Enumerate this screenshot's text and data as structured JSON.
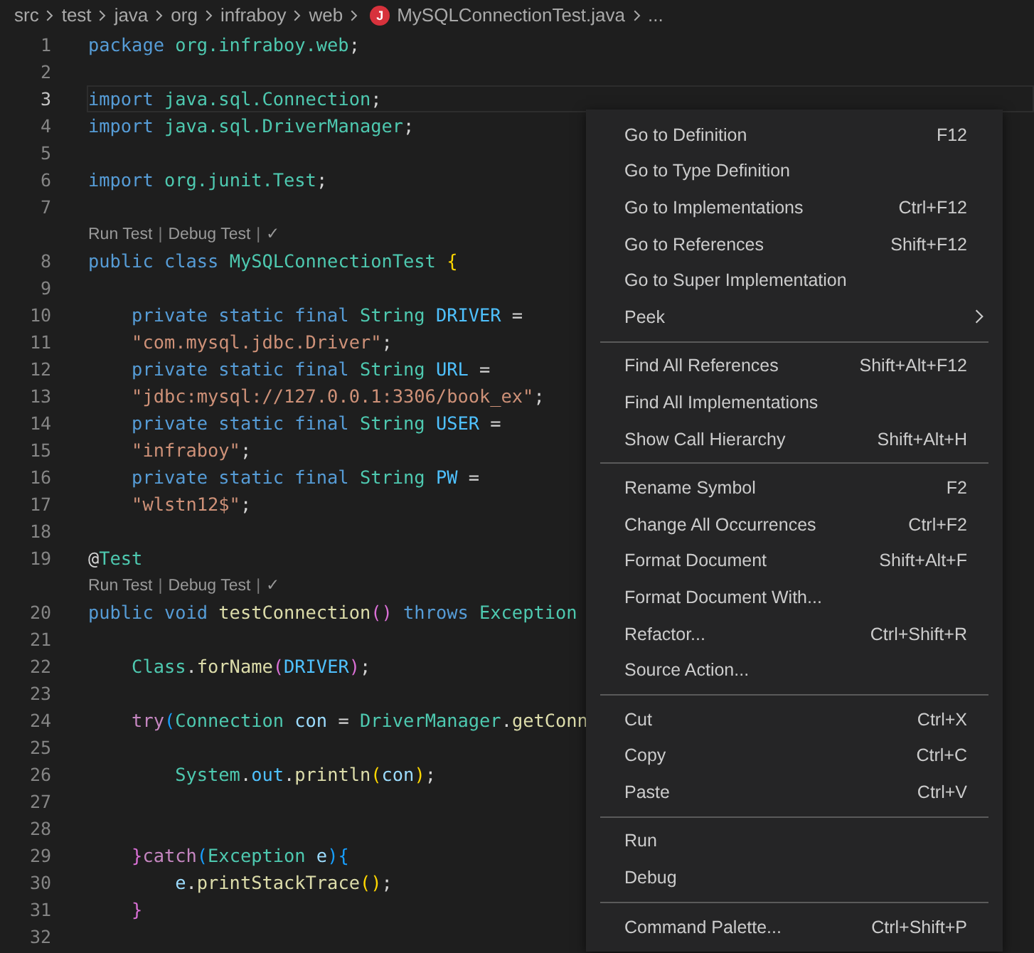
{
  "breadcrumb": {
    "segments": [
      "src",
      "test",
      "java",
      "org",
      "infraboy",
      "web"
    ],
    "file": {
      "badge": "J",
      "name": "MySQLConnectionTest.java"
    },
    "more": "..."
  },
  "rows": [
    {
      "kind": "code",
      "n": "1",
      "current": false,
      "code": [
        {
          "t": "package ",
          "kind": "kw"
        },
        {
          "t": "org.infraboy.web",
          "kind": "type"
        },
        {
          "t": ";",
          "kind": "punc"
        }
      ]
    },
    {
      "kind": "code",
      "n": "2",
      "current": false,
      "code": []
    },
    {
      "kind": "code",
      "n": "3",
      "current": true,
      "code": [
        {
          "t": "import ",
          "kind": "kw"
        },
        {
          "t": "java.sql.Connection",
          "kind": "type"
        },
        {
          "t": ";",
          "kind": "punc"
        }
      ]
    },
    {
      "kind": "code",
      "n": "4",
      "current": false,
      "code": [
        {
          "t": "import ",
          "kind": "kw"
        },
        {
          "t": "java.sql.DriverManager",
          "kind": "type"
        },
        {
          "t": ";",
          "kind": "punc"
        }
      ]
    },
    {
      "kind": "code",
      "n": "5",
      "current": false,
      "code": []
    },
    {
      "kind": "code",
      "n": "6",
      "current": false,
      "code": [
        {
          "t": "import ",
          "kind": "kw"
        },
        {
          "t": "org.junit.Test",
          "kind": "type"
        },
        {
          "t": ";",
          "kind": "punc"
        }
      ]
    },
    {
      "kind": "code",
      "n": "7",
      "current": false,
      "code": []
    },
    {
      "kind": "lens",
      "parts": [
        {
          "t": "Run Test",
          "kind": "link"
        },
        {
          "t": "|",
          "kind": "sep"
        },
        {
          "t": "Debug Test",
          "kind": "link"
        },
        {
          "t": "|",
          "kind": "sep"
        },
        {
          "t": "✓",
          "kind": "link"
        }
      ]
    },
    {
      "kind": "code",
      "n": "8",
      "current": false,
      "code": [
        {
          "t": "public class ",
          "kind": "kw"
        },
        {
          "t": "MySQLConnectionTest ",
          "kind": "type"
        },
        {
          "t": "{",
          "kind": "brace"
        }
      ]
    },
    {
      "kind": "code",
      "n": "9",
      "current": false,
      "code": []
    },
    {
      "kind": "code",
      "n": "10",
      "current": false,
      "code": [
        {
          "t": "    private static final ",
          "kind": "kw"
        },
        {
          "t": "String ",
          "kind": "type"
        },
        {
          "t": "DRIVER",
          "kind": "const"
        },
        {
          "t": " =",
          "kind": "punc"
        }
      ]
    },
    {
      "kind": "code",
      "n": "11",
      "current": false,
      "code": [
        {
          "t": "    \"com.mysql.jdbc.Driver\"",
          "kind": "str"
        },
        {
          "t": ";",
          "kind": "punc"
        }
      ]
    },
    {
      "kind": "code",
      "n": "12",
      "current": false,
      "code": [
        {
          "t": "    private static final ",
          "kind": "kw"
        },
        {
          "t": "String ",
          "kind": "type"
        },
        {
          "t": "URL",
          "kind": "const"
        },
        {
          "t": " =",
          "kind": "punc"
        }
      ]
    },
    {
      "kind": "code",
      "n": "13",
      "current": false,
      "code": [
        {
          "t": "    \"jdbc:mysql://127.0.0.1:3306/book_ex\"",
          "kind": "str"
        },
        {
          "t": ";",
          "kind": "punc"
        }
      ]
    },
    {
      "kind": "code",
      "n": "14",
      "current": false,
      "code": [
        {
          "t": "    private static final ",
          "kind": "kw"
        },
        {
          "t": "String ",
          "kind": "type"
        },
        {
          "t": "USER",
          "kind": "const"
        },
        {
          "t": " =",
          "kind": "punc"
        }
      ]
    },
    {
      "kind": "code",
      "n": "15",
      "current": false,
      "code": [
        {
          "t": "    \"infraboy\"",
          "kind": "str"
        },
        {
          "t": ";",
          "kind": "punc"
        }
      ]
    },
    {
      "kind": "code",
      "n": "16",
      "current": false,
      "code": [
        {
          "t": "    private static final ",
          "kind": "kw"
        },
        {
          "t": "String ",
          "kind": "type"
        },
        {
          "t": "PW",
          "kind": "const"
        },
        {
          "t": " =",
          "kind": "punc"
        }
      ]
    },
    {
      "kind": "code",
      "n": "17",
      "current": false,
      "code": [
        {
          "t": "    \"wlstn12$\"",
          "kind": "str"
        },
        {
          "t": ";",
          "kind": "punc"
        }
      ]
    },
    {
      "kind": "code",
      "n": "18",
      "current": false,
      "code": []
    },
    {
      "kind": "code",
      "n": "19",
      "current": false,
      "code": [
        {
          "t": "@",
          "kind": "punc"
        },
        {
          "t": "Test",
          "kind": "type"
        }
      ]
    },
    {
      "kind": "lens",
      "parts": [
        {
          "t": "Run Test",
          "kind": "link"
        },
        {
          "t": "|",
          "kind": "sep"
        },
        {
          "t": "Debug Test",
          "kind": "link"
        },
        {
          "t": "|",
          "kind": "sep"
        },
        {
          "t": "✓",
          "kind": "link"
        }
      ]
    },
    {
      "kind": "code",
      "n": "20",
      "current": false,
      "code": [
        {
          "t": "public void ",
          "kind": "kw"
        },
        {
          "t": "testConnection",
          "kind": "fn"
        },
        {
          "t": "()",
          "kind": "paren"
        },
        {
          "t": " throws ",
          "kind": "kw"
        },
        {
          "t": "Exception",
          "kind": "type"
        }
      ]
    },
    {
      "kind": "code",
      "n": "21",
      "current": false,
      "code": []
    },
    {
      "kind": "code",
      "n": "22",
      "current": false,
      "code": [
        {
          "t": "    Class",
          "kind": "type"
        },
        {
          "t": ".",
          "kind": "punc"
        },
        {
          "t": "forName",
          "kind": "fn"
        },
        {
          "t": "(",
          "kind": "paren"
        },
        {
          "t": "DRIVER",
          "kind": "const"
        },
        {
          "t": ")",
          "kind": "paren"
        },
        {
          "t": ";",
          "kind": "punc"
        }
      ]
    },
    {
      "kind": "code",
      "n": "23",
      "current": false,
      "code": []
    },
    {
      "kind": "code",
      "n": "24",
      "current": false,
      "code": [
        {
          "t": "    try",
          "kind": "ctrl"
        },
        {
          "t": "(",
          "kind": "paren2"
        },
        {
          "t": "Connection",
          "kind": "type"
        },
        {
          "t": " con",
          "kind": "var"
        },
        {
          "t": " = ",
          "kind": "punc"
        },
        {
          "t": "DriverManager",
          "kind": "type"
        },
        {
          "t": ".",
          "kind": "punc"
        },
        {
          "t": "getConn",
          "kind": "fn"
        }
      ]
    },
    {
      "kind": "code",
      "n": "25",
      "current": false,
      "code": []
    },
    {
      "kind": "code",
      "n": "26",
      "current": false,
      "code": [
        {
          "t": "        System",
          "kind": "type"
        },
        {
          "t": ".",
          "kind": "punc"
        },
        {
          "t": "out",
          "kind": "const"
        },
        {
          "t": ".",
          "kind": "punc"
        },
        {
          "t": "println",
          "kind": "fn"
        },
        {
          "t": "(",
          "kind": "brace"
        },
        {
          "t": "con",
          "kind": "var"
        },
        {
          "t": ")",
          "kind": "brace"
        },
        {
          "t": ";",
          "kind": "punc"
        }
      ]
    },
    {
      "kind": "code",
      "n": "27",
      "current": false,
      "code": []
    },
    {
      "kind": "code",
      "n": "28",
      "current": false,
      "code": []
    },
    {
      "kind": "code",
      "n": "29",
      "current": false,
      "code": [
        {
          "t": "    }",
          "kind": "paren"
        },
        {
          "t": "catch",
          "kind": "ctrl"
        },
        {
          "t": "(",
          "kind": "paren2"
        },
        {
          "t": "Exception",
          "kind": "type"
        },
        {
          "t": " e",
          "kind": "var"
        },
        {
          "t": "){",
          "kind": "paren2"
        }
      ]
    },
    {
      "kind": "code",
      "n": "30",
      "current": false,
      "code": [
        {
          "t": "        e",
          "kind": "var"
        },
        {
          "t": ".",
          "kind": "punc"
        },
        {
          "t": "printStackTrace",
          "kind": "fn"
        },
        {
          "t": "()",
          "kind": "brace"
        },
        {
          "t": ";",
          "kind": "punc"
        }
      ]
    },
    {
      "kind": "code",
      "n": "31",
      "current": false,
      "code": [
        {
          "t": "    }",
          "kind": "paren"
        }
      ]
    },
    {
      "kind": "code",
      "n": "32",
      "current": false,
      "code": []
    }
  ],
  "context_menu": {
    "groups": [
      [
        {
          "label": "Go to Definition",
          "shortcut": "F12",
          "submenu": false
        },
        {
          "label": "Go to Type Definition",
          "submenu": false
        },
        {
          "label": "Go to Implementations",
          "shortcut": "Ctrl+F12",
          "submenu": false
        },
        {
          "label": "Go to References",
          "shortcut": "Shift+F12",
          "submenu": false
        },
        {
          "label": "Go to Super Implementation",
          "submenu": false
        },
        {
          "label": "Peek",
          "submenu": true
        }
      ],
      [
        {
          "label": "Find All References",
          "shortcut": "Shift+Alt+F12",
          "submenu": false
        },
        {
          "label": "Find All Implementations",
          "submenu": false
        },
        {
          "label": "Show Call Hierarchy",
          "shortcut": "Shift+Alt+H",
          "submenu": false
        }
      ],
      [
        {
          "label": "Rename Symbol",
          "shortcut": "F2",
          "submenu": false
        },
        {
          "label": "Change All Occurrences",
          "shortcut": "Ctrl+F2",
          "submenu": false
        },
        {
          "label": "Format Document",
          "shortcut": "Shift+Alt+F",
          "submenu": false
        },
        {
          "label": "Format Document With...",
          "submenu": false
        },
        {
          "label": "Refactor...",
          "shortcut": "Ctrl+Shift+R",
          "submenu": false
        },
        {
          "label": "Source Action...",
          "submenu": false
        }
      ],
      [
        {
          "label": "Cut",
          "shortcut": "Ctrl+X",
          "submenu": false
        },
        {
          "label": "Copy",
          "shortcut": "Ctrl+C",
          "submenu": false
        },
        {
          "label": "Paste",
          "shortcut": "Ctrl+V",
          "submenu": false
        }
      ],
      [
        {
          "label": "Run",
          "submenu": false
        },
        {
          "label": "Debug",
          "submenu": false
        }
      ],
      [
        {
          "label": "Command Palette...",
          "shortcut": "Ctrl+Shift+P",
          "submenu": false
        }
      ]
    ]
  }
}
